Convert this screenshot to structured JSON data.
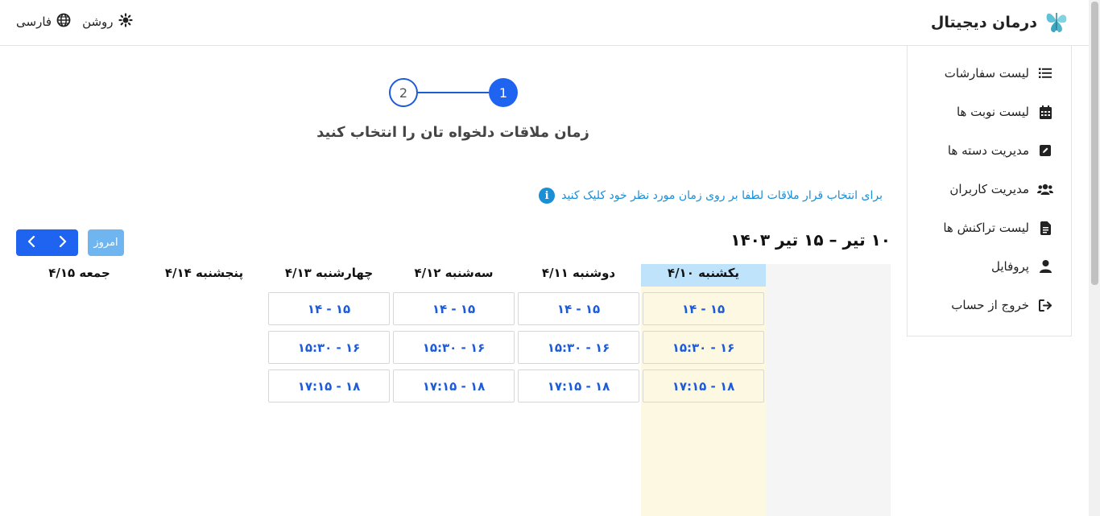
{
  "header": {
    "brand_title": "درمان دیجیتال",
    "theme_label": "روشن",
    "language_label": "فارسی"
  },
  "sidebar": {
    "items": [
      {
        "label": "لیست سفارشات",
        "icon": "list-icon"
      },
      {
        "label": "لیست نوبت ها",
        "icon": "calendar-icon"
      },
      {
        "label": "مدیریت دسته ها",
        "icon": "edit-icon"
      },
      {
        "label": "مدیریت کاربران",
        "icon": "users-icon"
      },
      {
        "label": "لیست تراکنش ها",
        "icon": "document-icon"
      },
      {
        "label": "پروفایل",
        "icon": "user-icon"
      },
      {
        "label": "خروج از حساب",
        "icon": "logout-icon"
      }
    ]
  },
  "stepper": {
    "step1": "1",
    "step2": "2",
    "title": "زمان ملاقات دلخواه تان را انتخاب کنید"
  },
  "info": {
    "text": "برای انتخاب قرار ملاقات لطفا بر روی زمان مورد نظر خود کلیک کنید"
  },
  "calendar": {
    "range_title": "۱۰ تیر – ۱۵ تیر ۱۴۰۳",
    "today_label": "امروز",
    "days": [
      {
        "label": "یکشنبه ۴/۱۰",
        "slots": [
          "۱۴ - ۱۵",
          "۱۵:۳۰ - ۱۶",
          "۱۷:۱۵ - ۱۸"
        ]
      },
      {
        "label": "دوشنبه ۴/۱۱",
        "slots": [
          "۱۴ - ۱۵",
          "۱۵:۳۰ - ۱۶",
          "۱۷:۱۵ - ۱۸"
        ]
      },
      {
        "label": "سه‌شنبه ۴/۱۲",
        "slots": [
          "۱۴ - ۱۵",
          "۱۵:۳۰ - ۱۶",
          "۱۷:۱۵ - ۱۸"
        ]
      },
      {
        "label": "چهارشنبه ۴/۱۳",
        "slots": [
          "۱۴ - ۱۵",
          "۱۵:۳۰ - ۱۶",
          "۱۷:۱۵ - ۱۸"
        ]
      },
      {
        "label": "پنجشنبه ۴/۱۴",
        "slots": []
      },
      {
        "label": "جمعه ۴/۱۵",
        "slots": []
      }
    ]
  },
  "colors": {
    "primary": "#1e64f0",
    "info": "#1a8fd6",
    "today_header": "#bfe3fb",
    "today_column": "#fdf8e1"
  }
}
